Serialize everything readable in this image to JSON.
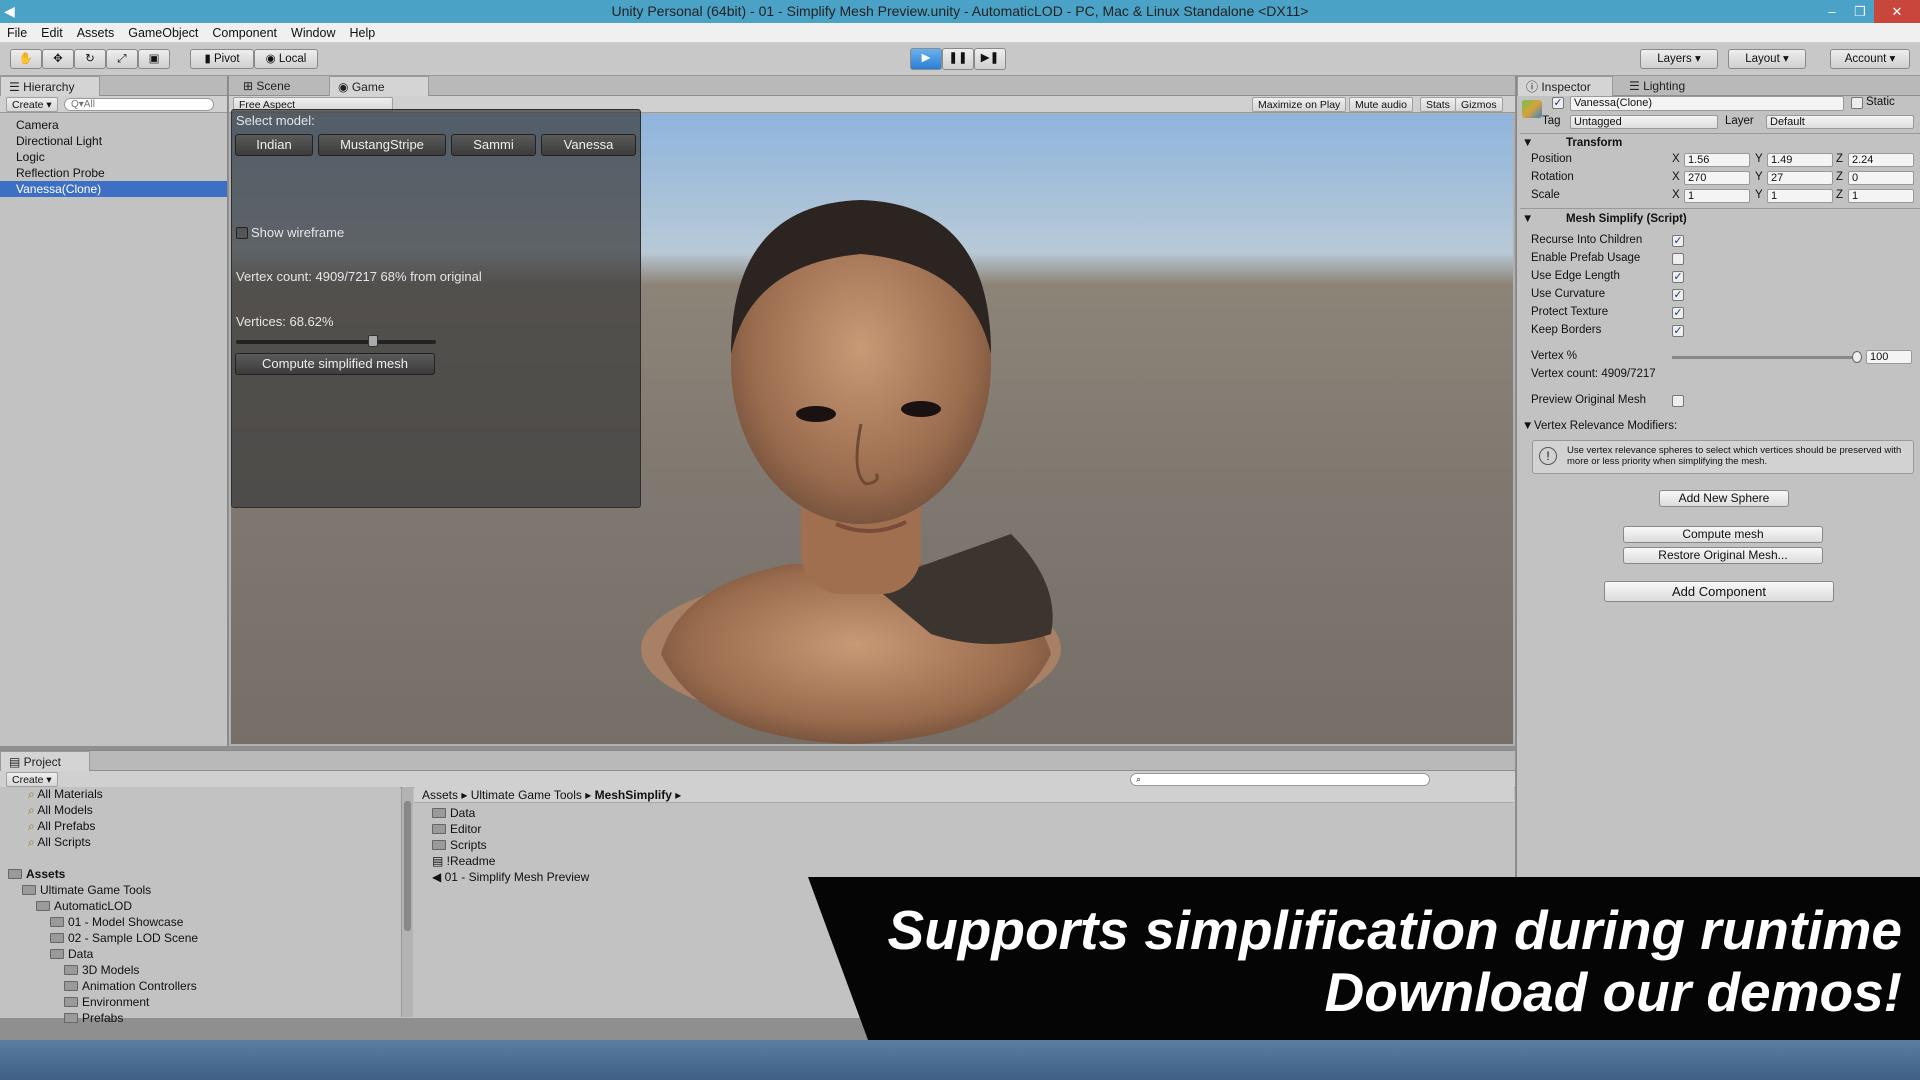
{
  "window": {
    "title": "Unity Personal (64bit) - 01 - Simplify Mesh Preview.unity - AutomaticLOD - PC, Mac & Linux Standalone <DX11>"
  },
  "menu": [
    "File",
    "Edit",
    "Assets",
    "GameObject",
    "Component",
    "Window",
    "Help"
  ],
  "toolbar": {
    "pivot": "Pivot",
    "local": "Local",
    "layers": "Layers",
    "layout": "Layout",
    "account": "Account"
  },
  "hierarchy": {
    "tab": "Hierarchy",
    "create": "Create",
    "search_placeholder": "Q▾All",
    "items": [
      "Camera",
      "Directional Light",
      "Logic",
      "Reflection Probe",
      "Vanessa(Clone)"
    ]
  },
  "scene_tabs": {
    "scene": "Scene",
    "game": "Game",
    "aspect": "Free Aspect",
    "maximize": "Maximize on Play",
    "mute": "Mute audio",
    "stats": "Stats",
    "gizmos": "Gizmos"
  },
  "game_ui": {
    "select_model": "Select model:",
    "models": [
      "Indian",
      "MustangStripe",
      "Sammi",
      "Vanessa"
    ],
    "show_wireframe": "Show wireframe",
    "vertex_count": "Vertex count: 4909/7217 68% from original",
    "vertices": "Vertices: 68.62%",
    "vertices_fraction": 0.6862,
    "compute": "Compute simplified mesh"
  },
  "inspector": {
    "tab": "Inspector",
    "lighting": "Lighting",
    "object_name": "Vanessa(Clone)",
    "static": "Static",
    "tag_label": "Tag",
    "tag_value": "Untagged",
    "layer_label": "Layer",
    "layer_value": "Default",
    "transform": {
      "title": "Transform",
      "position": {
        "label": "Position",
        "x": "1.56",
        "y": "1.49",
        "z": "2.24"
      },
      "rotation": {
        "label": "Rotation",
        "x": "270",
        "y": "27",
        "z": "0"
      },
      "scale": {
        "label": "Scale",
        "x": "1",
        "y": "1",
        "z": "1"
      }
    },
    "mesh_simplify": {
      "title": "Mesh Simplify (Script)",
      "options": [
        {
          "label": "Recurse Into Children",
          "checked": true
        },
        {
          "label": "Enable Prefab Usage",
          "checked": false
        },
        {
          "label": "Use Edge Length",
          "checked": true
        },
        {
          "label": "Use Curvature",
          "checked": true
        },
        {
          "label": "Protect Texture",
          "checked": true
        },
        {
          "label": "Keep Borders",
          "checked": true
        }
      ],
      "vertex_pct_label": "Vertex %",
      "vertex_pct_value": "100",
      "vertex_count": "Vertex count: 4909/7217",
      "preview_original": "Preview Original Mesh",
      "relevance": "Vertex Relevance Modifiers:",
      "help": "Use vertex relevance spheres to select which vertices should be preserved with more or less priority when simplifying the mesh.",
      "add_sphere": "Add New Sphere",
      "compute_mesh": "Compute mesh",
      "restore": "Restore Original Mesh..."
    },
    "add_component": "Add Component"
  },
  "project": {
    "tab": "Project",
    "create": "Create",
    "favorites": [
      "All Materials",
      "All Models",
      "All Prefabs",
      "All Scripts"
    ],
    "tree": [
      {
        "label": "Assets",
        "indent": 0,
        "bold": true
      },
      {
        "label": "Ultimate Game Tools",
        "indent": 1
      },
      {
        "label": "AutomaticLOD",
        "indent": 2
      },
      {
        "label": "01 - Model Showcase",
        "indent": 3
      },
      {
        "label": "02 - Sample LOD Scene",
        "indent": 3
      },
      {
        "label": "Data",
        "indent": 3
      },
      {
        "label": "3D Models",
        "indent": 4
      },
      {
        "label": "Animation Controllers",
        "indent": 4
      },
      {
        "label": "Environment",
        "indent": 4
      },
      {
        "label": "Prefabs",
        "indent": 4
      }
    ],
    "breadcrumb": [
      "Assets",
      "Ultimate Game Tools",
      "MeshSimplify"
    ],
    "files": [
      "Data",
      "Editor",
      "Scripts",
      "!Readme",
      "01 - Simplify Mesh Preview"
    ]
  },
  "banner": {
    "line1": "Supports simplification during runtime",
    "line2": "Download our demos!"
  }
}
